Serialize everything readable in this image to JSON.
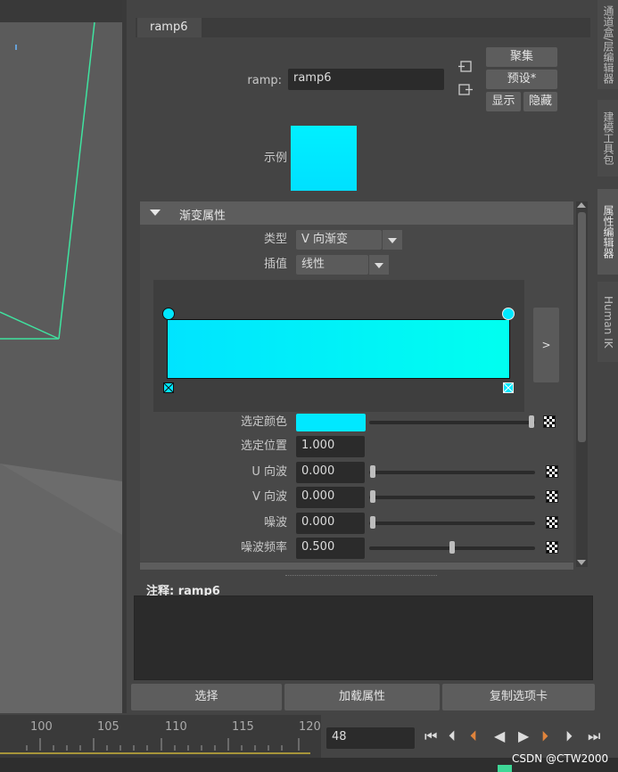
{
  "node_tab": "ramp6",
  "ramp_label": "ramp:",
  "ramp_value": "ramp6",
  "buttons": {
    "focus": "聚集",
    "presets": "预设*",
    "show": "显示",
    "hide": "隐藏"
  },
  "sample_label": "示例",
  "section_title": "渐变属性",
  "type_label": "类型",
  "type_value": "V 向渐变",
  "interp_label": "插值",
  "interp_value": "线性",
  "expand_button": ">",
  "rows": [
    {
      "label": "选定颜色",
      "kind": "color",
      "slider": 1.0
    },
    {
      "label": "选定位置",
      "value": "1.000"
    },
    {
      "label": "U 向波",
      "value": "0.000",
      "slider": 0.0
    },
    {
      "label": "V 向波",
      "value": "0.000",
      "slider": 0.0
    },
    {
      "label": "噪波",
      "value": "0.000",
      "slider": 0.0
    },
    {
      "label": "噪波频率",
      "value": "0.500",
      "slider": 0.5
    }
  ],
  "notes_label": "注释: ramp6",
  "bottom_buttons": {
    "select": "选择",
    "load": "加载属性",
    "copy_tab": "复制选项卡"
  },
  "side_tabs": [
    "通道盒/层编辑器",
    "建模工具包",
    "属性编辑器",
    "Human IK"
  ],
  "timeline_ticks": [
    "100",
    "105",
    "110",
    "115",
    "120"
  ],
  "current_frame": "48",
  "watermark": "CSDN @CTW2000",
  "colors": {
    "ramp_cyan": "#00e8ff",
    "accent_green": "#3ed796",
    "playhead": "#e0843c"
  }
}
